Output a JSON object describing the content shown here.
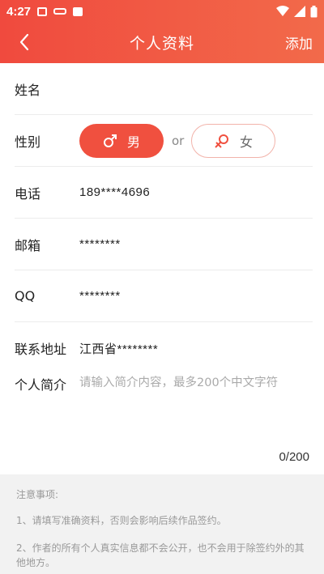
{
  "status": {
    "time": "4:27"
  },
  "header": {
    "title": "个人资料",
    "add_label": "添加"
  },
  "form": {
    "name": {
      "label": "姓名",
      "value": ""
    },
    "gender": {
      "label": "性别",
      "male": "男",
      "female": "女",
      "or": "or",
      "selected": "male"
    },
    "phone": {
      "label": "电话",
      "value": "189****4696"
    },
    "email": {
      "label": "邮箱",
      "value": "********"
    },
    "qq": {
      "label": "QQ",
      "value": "********"
    },
    "address": {
      "label": "联系地址",
      "value": "江西省********"
    },
    "intro": {
      "label": "个人简介",
      "placeholder": "请输入简介内容，最多200个中文字符",
      "counter": "0/200"
    }
  },
  "notes": {
    "title": "注意事项:",
    "items": [
      "1、请填写准确资料，否则会影响后续作品签约。",
      "2、作者的所有个人真实信息都不会公开，也不会用于除签约外的其他地方。"
    ]
  },
  "colors": {
    "accent": "#f0503f"
  }
}
